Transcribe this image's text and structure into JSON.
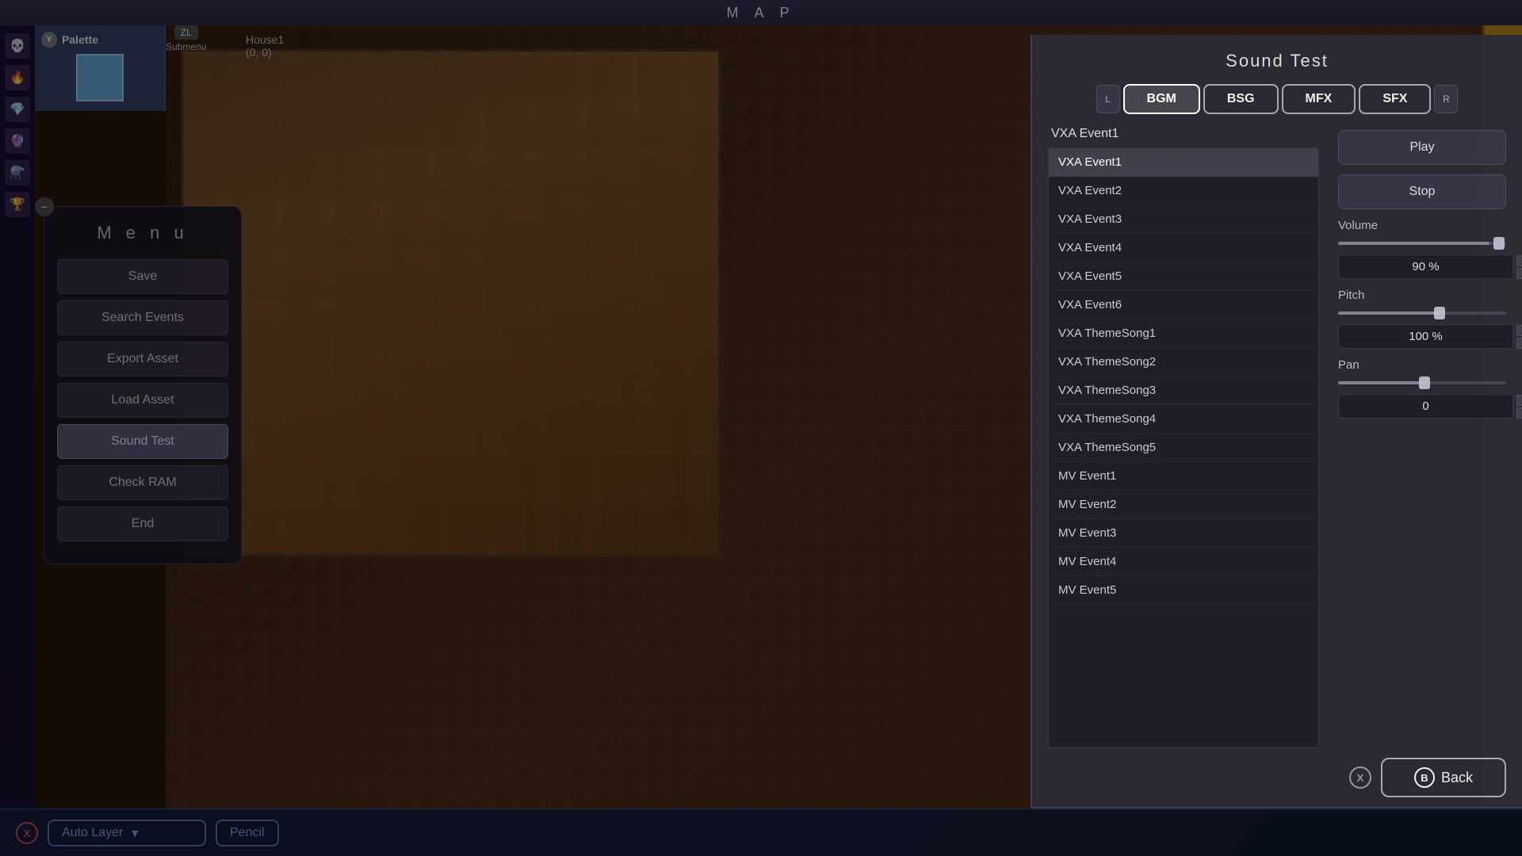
{
  "topBar": {
    "mapTitle": "M a p"
  },
  "palette": {
    "yLabel": "Y",
    "title": "Palette"
  },
  "submenu": {
    "zlLabel": "ZL",
    "label": "Submenu"
  },
  "mapLocation": {
    "name": "House1",
    "coords": "(0, 0)"
  },
  "menu": {
    "title": "M e n u",
    "buttons": [
      {
        "label": "Save",
        "active": false
      },
      {
        "label": "Search Events",
        "active": false
      },
      {
        "label": "Export Asset",
        "active": false
      },
      {
        "label": "Load Asset",
        "active": false
      },
      {
        "label": "Sound Test",
        "active": true
      },
      {
        "label": "Check RAM",
        "active": false
      },
      {
        "label": "End",
        "active": false
      }
    ]
  },
  "bottomBar": {
    "xLabel": "X",
    "autoLayerLabel": "Auto Layer",
    "pencilLabel": "Pencil"
  },
  "soundTest": {
    "title": "Sound Test",
    "tabs": [
      {
        "label": "BGM",
        "active": true
      },
      {
        "label": "BSG",
        "active": false
      },
      {
        "label": "MFX",
        "active": false
      },
      {
        "label": "SFX",
        "active": false
      }
    ],
    "leftNavLabel": "L",
    "rightNavLabel": "R",
    "selectedCategory": "VXA Event1",
    "playLabel": "Play",
    "stopLabel": "Stop",
    "volumeLabel": "Volume",
    "volumeValue": "90 %",
    "pitchLabel": "Pitch",
    "pitchValue": "100 %",
    "panLabel": "Pan",
    "panValue": "0",
    "backLabel": "Back",
    "bLabel": "B",
    "xCloseLabel": "X",
    "soundList": [
      {
        "name": "VXA Event1",
        "selected": true
      },
      {
        "name": "VXA Event2",
        "selected": false
      },
      {
        "name": "VXA Event3",
        "selected": false
      },
      {
        "name": "VXA Event4",
        "selected": false
      },
      {
        "name": "VXA Event5",
        "selected": false
      },
      {
        "name": "VXA Event6",
        "selected": false
      },
      {
        "name": "VXA ThemeSong1",
        "selected": false
      },
      {
        "name": "VXA ThemeSong2",
        "selected": false
      },
      {
        "name": "VXA ThemeSong3",
        "selected": false
      },
      {
        "name": "VXA ThemeSong4",
        "selected": false
      },
      {
        "name": "VXA ThemeSong5",
        "selected": false
      },
      {
        "name": "MV Event1",
        "selected": false
      },
      {
        "name": "MV Event2",
        "selected": false
      },
      {
        "name": "MV Event3",
        "selected": false
      },
      {
        "name": "MV Event4",
        "selected": false
      },
      {
        "name": "MV Event5",
        "selected": false
      }
    ]
  }
}
